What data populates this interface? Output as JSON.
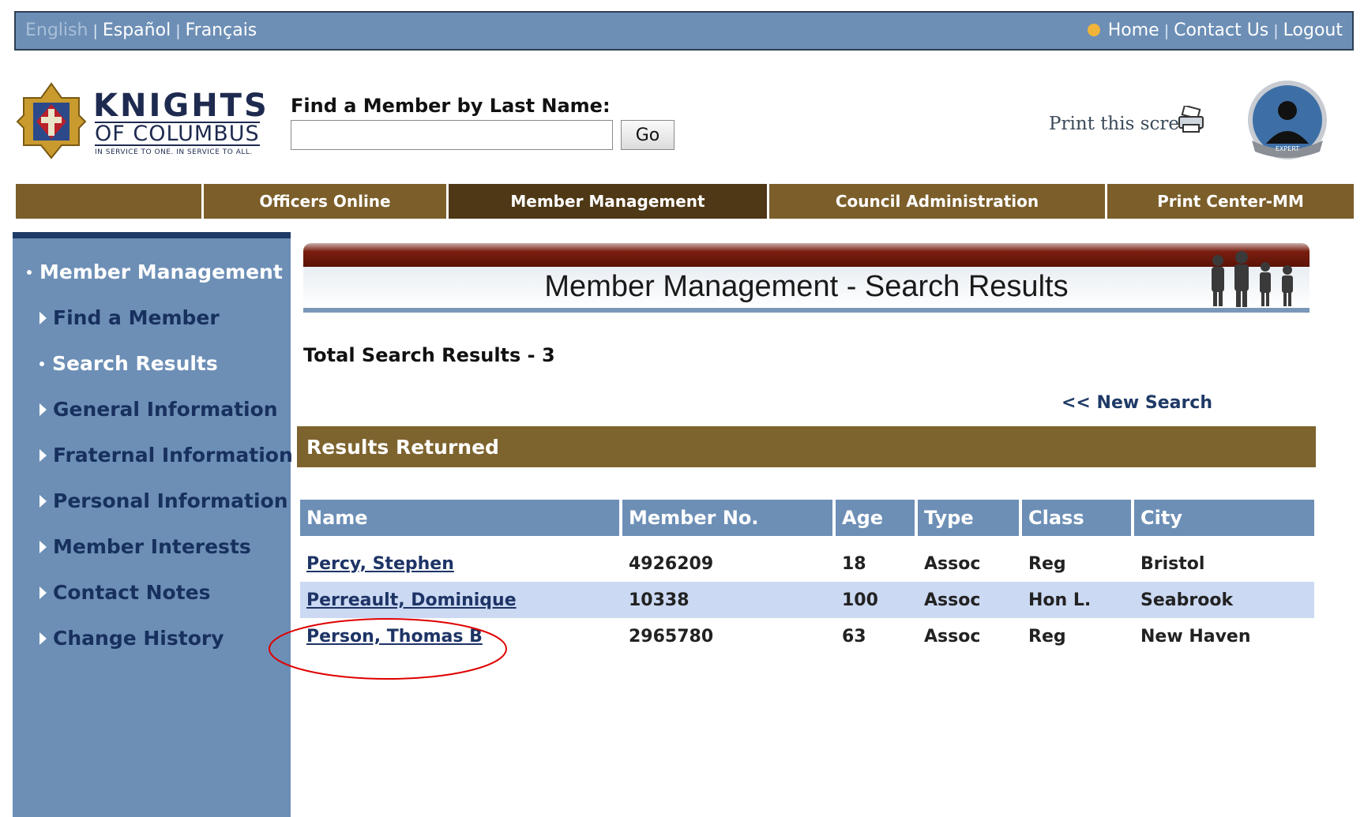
{
  "topbar": {
    "lang_english": "English",
    "lang_espanol": "Español",
    "lang_francais": "Français",
    "home": "Home",
    "contact": "Contact Us",
    "logout": "Logout"
  },
  "logo": {
    "line1": "KNIGHTS",
    "line2": "OF COLUMBUS",
    "tagline": "IN SERVICE TO ONE. IN SERVICE TO ALL."
  },
  "search": {
    "label": "Find a Member by Last Name:",
    "value": "",
    "go": "Go"
  },
  "print": "Print this screen",
  "expert_badge": "EXPERT",
  "nav": {
    "tabs": [
      "",
      "Officers Online",
      "Member Management",
      "Council Administration",
      "Print Center-MM"
    ]
  },
  "sidebar": {
    "items": [
      "Member Management",
      "Find a Member",
      "Search Results",
      "General Information",
      "Fraternal Information",
      "Personal Information",
      "Member Interests",
      "Contact Notes",
      "Change History"
    ]
  },
  "main": {
    "title": "Member Management - Search Results",
    "total": "Total Search Results - 3",
    "new_search": "<< New Search",
    "results_header": "Results Returned",
    "columns": [
      "Name",
      "Member No.",
      "Age",
      "Type",
      "Class",
      "City"
    ],
    "rows": [
      [
        "Percy, Stephen",
        "4926209",
        "18",
        "Assoc",
        "Reg",
        "Bristol"
      ],
      [
        "Perreault, Dominique",
        "10338",
        "100",
        "Assoc",
        "Hon L.",
        "Seabrook"
      ],
      [
        "Person, Thomas B",
        "2965780",
        "63",
        "Assoc",
        "Reg",
        "New Haven"
      ]
    ]
  },
  "colors": {
    "topbar": "#6d8fb6",
    "nav": "#7b5e2a",
    "nav_active": "#4e3815",
    "results_header": "#7d632e",
    "row_alt": "#cbd9f3",
    "annotation": "#e00000"
  }
}
